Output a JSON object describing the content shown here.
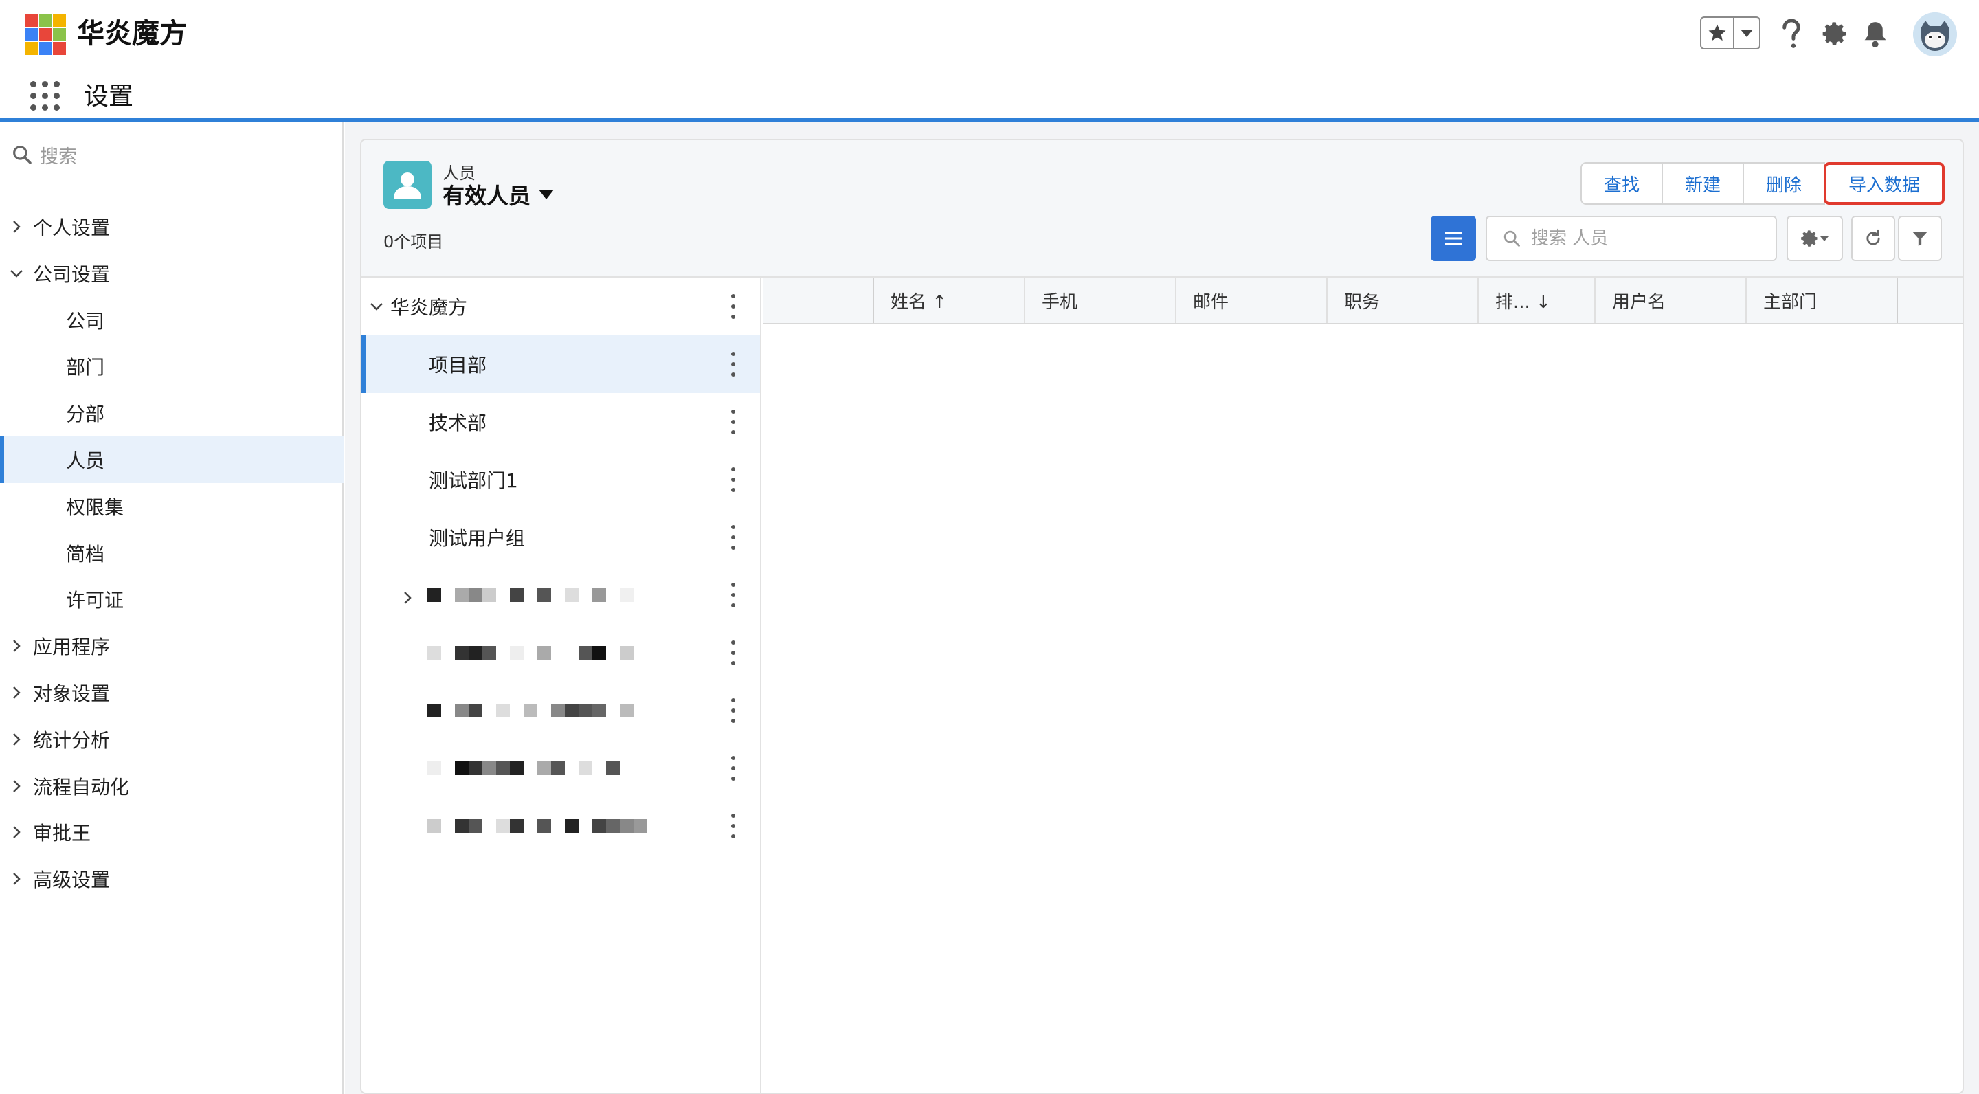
{
  "header": {
    "app_name": "华炎魔方",
    "logo_colors": [
      "#e8463a",
      "#8bc34a",
      "#f4b400",
      "#3b82f6",
      "#e8463a",
      "#8bc34a",
      "#f4b400",
      "#3b82f6",
      "#e8463a"
    ],
    "icons": [
      "star-icon",
      "chevron-down-icon",
      "help-icon",
      "gear-icon",
      "bell-icon",
      "avatar"
    ]
  },
  "subbar": {
    "title": "设置"
  },
  "sidebar": {
    "search_placeholder": "搜索",
    "items": [
      {
        "label": "个人设置",
        "expandable": true,
        "expanded": false
      },
      {
        "label": "公司设置",
        "expandable": true,
        "expanded": true
      },
      {
        "label": "公司",
        "sub": true
      },
      {
        "label": "部门",
        "sub": true
      },
      {
        "label": "分部",
        "sub": true
      },
      {
        "label": "人员",
        "sub": true,
        "active": true
      },
      {
        "label": "权限集",
        "sub": true
      },
      {
        "label": "简档",
        "sub": true
      },
      {
        "label": "许可证",
        "sub": true
      },
      {
        "label": "应用程序",
        "expandable": true
      },
      {
        "label": "对象设置",
        "expandable": true
      },
      {
        "label": "统计分析",
        "expandable": true
      },
      {
        "label": "流程自动化",
        "expandable": true
      },
      {
        "label": "审批王",
        "expandable": true
      },
      {
        "label": "高级设置",
        "expandable": true
      }
    ]
  },
  "main": {
    "object_label": "人员",
    "view_name": "有效人员",
    "count": "0个项目",
    "buttons": {
      "find": "查找",
      "new": "新建",
      "delete": "删除",
      "import": "导入数据"
    },
    "search_placeholder": "搜索 人员",
    "tree": {
      "root": "华炎魔方",
      "children": [
        "项目部",
        "技术部",
        "测试部门1",
        "测试用户组"
      ],
      "selected": "项目部"
    },
    "columns": [
      "姓名 ↑",
      "手机",
      "邮件",
      "职务",
      "排... ↓",
      "用户名",
      "主部门"
    ],
    "accent_color": "#2f80d8",
    "highlight_color": "#e03a2e"
  }
}
